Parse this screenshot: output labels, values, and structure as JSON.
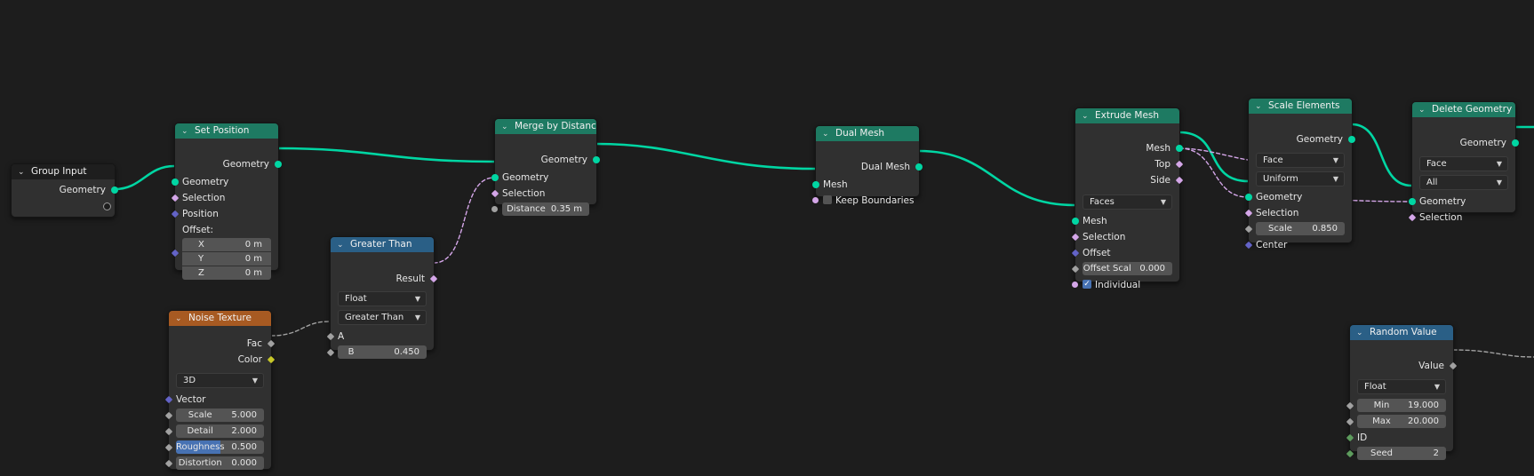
{
  "colors": {
    "background": "#1d1d1d",
    "node_body": "#303030",
    "geometry_header": "#1e7a62",
    "math_header": "#2a5f86",
    "texture_header": "#a75a22",
    "geometry_socket": "#00d6a3",
    "bool_socket": "#d4a6e8",
    "float_socket": "#a1a1a1",
    "vector_socket": "#6363c7",
    "color_socket": "#c7c729",
    "int_socket": "#5d9c5d",
    "accent": "#4772b3"
  },
  "icons": {
    "collapse": "chevron-down-icon",
    "dropdown": "chevron-down-icon",
    "check": "checkmark-icon"
  },
  "nodes": {
    "group_input": {
      "title": "Group Input",
      "out_geometry": "Geometry"
    },
    "set_position": {
      "title": "Set Position",
      "out_geometry": "Geometry",
      "in_geometry": "Geometry",
      "in_selection": "Selection",
      "in_position": "Position",
      "offset_label": "Offset:",
      "x_label": "X",
      "x_value": "0 m",
      "y_label": "Y",
      "y_value": "0 m",
      "z_label": "Z",
      "z_value": "0 m"
    },
    "noise_texture": {
      "title": "Noise Texture",
      "out_fac": "Fac",
      "out_color": "Color",
      "dimensions": "3D",
      "in_vector": "Vector",
      "scale_label": "Scale",
      "scale_value": "5.000",
      "detail_label": "Detail",
      "detail_value": "2.000",
      "roughness_label": "Roughness",
      "roughness_value": "0.500",
      "distortion_label": "Distortion",
      "distortion_value": "0.000"
    },
    "greater_than": {
      "title": "Greater Than",
      "out_result": "Result",
      "data_type": "Float",
      "operation": "Greater Than",
      "in_a": "A",
      "b_label": "B",
      "b_value": "0.450"
    },
    "merge_by_distance": {
      "title": "Merge by Distance",
      "out_geometry": "Geometry",
      "in_geometry": "Geometry",
      "in_selection": "Selection",
      "distance_label": "Distance",
      "distance_value": "0.35 m"
    },
    "dual_mesh": {
      "title": "Dual Mesh",
      "out_dual_mesh": "Dual Mesh",
      "in_mesh": "Mesh",
      "keep_boundaries": "Keep Boundaries"
    },
    "extrude_mesh": {
      "title": "Extrude Mesh",
      "out_mesh": "Mesh",
      "out_top": "Top",
      "out_side": "Side",
      "mode": "Faces",
      "in_mesh": "Mesh",
      "in_selection": "Selection",
      "in_offset": "Offset",
      "offset_scale_label": "Offset Scal",
      "offset_scale_value": "0.000",
      "individual_label": "Individual"
    },
    "scale_elements": {
      "title": "Scale Elements",
      "out_geometry": "Geometry",
      "domain": "Face",
      "scale_mode": "Uniform",
      "in_geometry": "Geometry",
      "in_selection": "Selection",
      "scale_label": "Scale",
      "scale_value": "0.850",
      "in_center": "Center"
    },
    "delete_geometry": {
      "title": "Delete Geometry",
      "out_geometry": "Geometry",
      "domain": "Face",
      "mode": "All",
      "in_geometry": "Geometry",
      "in_selection": "Selection"
    },
    "random_value": {
      "title": "Random Value",
      "out_value": "Value",
      "data_type": "Float",
      "min_label": "Min",
      "min_value": "19.000",
      "max_label": "Max",
      "max_value": "20.000",
      "in_id": "ID",
      "seed_label": "Seed",
      "seed_value": "2"
    }
  }
}
